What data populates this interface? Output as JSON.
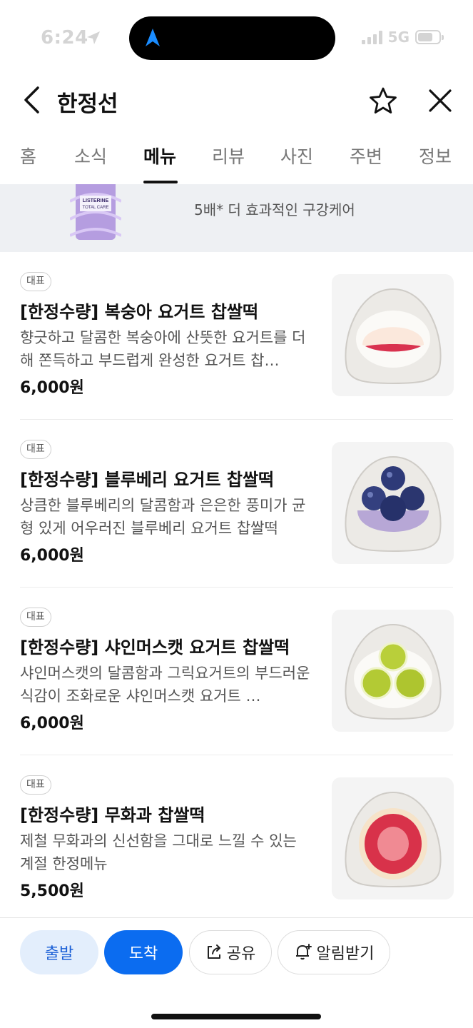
{
  "status": {
    "time": "6:24",
    "network": "5G",
    "battery_level": 0.7
  },
  "header": {
    "title": "한정선"
  },
  "tabs": [
    {
      "label": "홈",
      "active": false
    },
    {
      "label": "소식",
      "active": false
    },
    {
      "label": "메뉴",
      "active": true
    },
    {
      "label": "리뷰",
      "active": false
    },
    {
      "label": "사진",
      "active": false
    },
    {
      "label": "주변",
      "active": false
    },
    {
      "label": "정보",
      "active": false
    }
  ],
  "ad": {
    "headline": "",
    "subtext": "5배* 더 효과적인 구강케어",
    "brand_lines": [
      "LISTERINE",
      "TOTAL CARE"
    ]
  },
  "menu": [
    {
      "badge": "대표",
      "name": "[한정수량] 복숭아 요거트 찹쌀떡",
      "description": "향긋하고 달콤한 복숭아에 산뜻한 요거트를 더해 쫀득하고 부드럽게 완성한 요거트 찹…",
      "price": "6,000원"
    },
    {
      "badge": "대표",
      "name": "[한정수량] 블루베리 요거트 찹쌀떡",
      "description": "상큼한 블루베리의 달콤함과 은은한 풍미가 균형 있게 어우러진 블루베리 요거트 찹쌀떡",
      "price": "6,000원"
    },
    {
      "badge": "대표",
      "name": "[한정수량] 샤인머스캣 요거트 찹쌀떡",
      "description": "샤인머스캣의 달콤함과 그릭요거트의 부드러운 식감이 조화로운 샤인머스캣 요거트 …",
      "price": "6,000원"
    },
    {
      "badge": "대표",
      "name": "[한정수량] 무화과 찹쌀떡",
      "description": "제철 무화과의 신선함을 그대로 느낄 수 있는 계절 한정메뉴",
      "price": "5,500원"
    }
  ],
  "bottom_bar": {
    "depart_label": "출발",
    "arrive_label": "도착",
    "share_label": "공유",
    "notify_label": "알림받기"
  },
  "colors": {
    "primary": "#0b6cf0",
    "primary_light": "#e3eefc",
    "nav_arrow": "#1a8cff"
  }
}
